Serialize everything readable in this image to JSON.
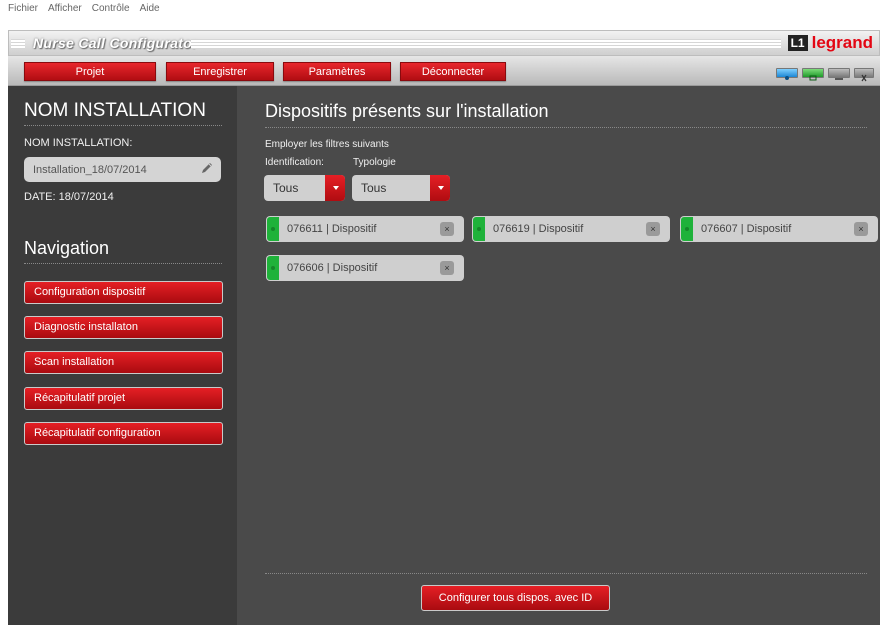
{
  "menu": [
    "Fichier",
    "Afficher",
    "Contrôle",
    "Aide"
  ],
  "app": {
    "title": "Nurse Call Configurator",
    "brand": "legrand",
    "brand_mark": "L1"
  },
  "toolbar": {
    "buttons": [
      {
        "label": "Projet"
      },
      {
        "label": "Enregistrer"
      },
      {
        "label": "Paramètres"
      },
      {
        "label": "Déconnecter"
      }
    ],
    "window_icons": [
      "help-icon",
      "restore-icon",
      "minimize-icon",
      "close-icon"
    ]
  },
  "sidebar": {
    "install_heading": "NOM INSTALLATION",
    "install_label": "NOM INSTALLATION:",
    "install_value": "Installation_18/07/2014",
    "date": "DATE: 18/07/2014",
    "nav_heading": "Navigation",
    "nav_items": [
      "Configuration dispositif",
      "Diagnostic installaton",
      "Scan installation",
      "Récapitulatif projet",
      "Récapitulatif configuration"
    ]
  },
  "main": {
    "heading": "Dispositifs présents sur l'installation",
    "filter_caption": "Employer les filtres suivants",
    "filters": [
      {
        "label": "Identification:",
        "value": "Tous"
      },
      {
        "label": "Typologie",
        "value": "Tous"
      }
    ],
    "devices": [
      "076611 | Dispositif",
      "076619 | Dispositif",
      "076607 | Dispositif",
      "076606 | Dispositif"
    ],
    "config_all_button": "Configurer tous dispos. avec ID"
  },
  "colors": {
    "accent_red": "#d4141a",
    "led_green": "#1fb23a",
    "sidebar_bg": "#3b3b3b",
    "main_bg": "#4a4a4a"
  }
}
